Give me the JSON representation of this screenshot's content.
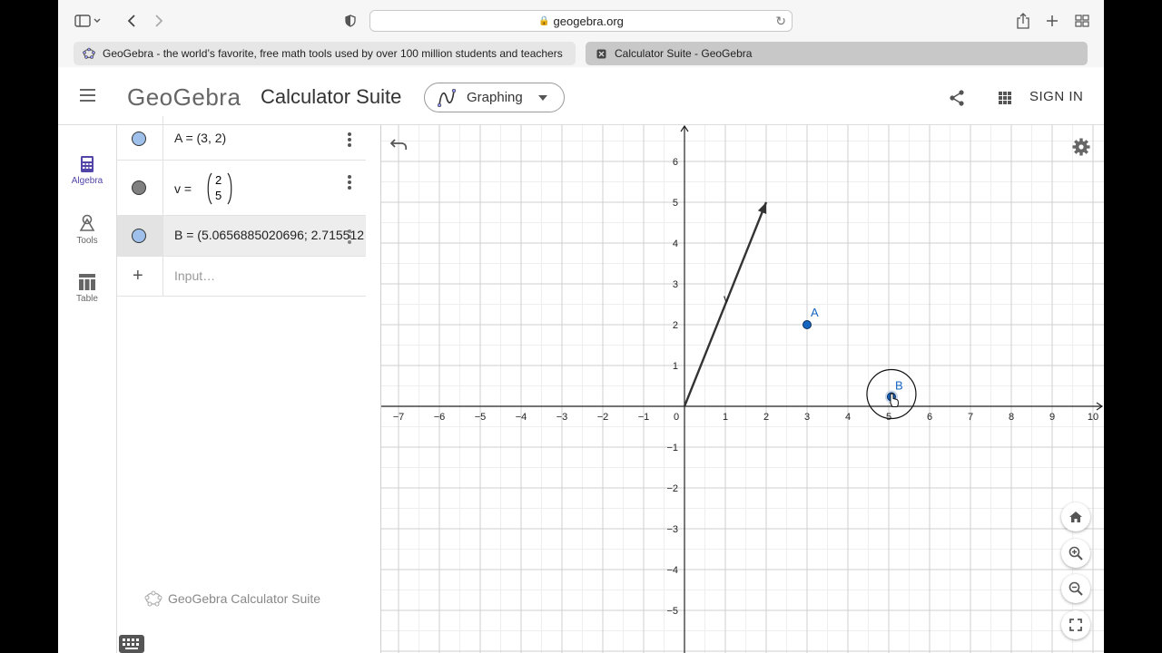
{
  "browser": {
    "url": "geogebra.org",
    "tabs": [
      {
        "title": "GeoGebra - the world’s favorite, free math tools used by over 100 million students and teachers"
      },
      {
        "title": "Calculator Suite - GeoGebra"
      }
    ]
  },
  "header": {
    "logo": "GeoGebra",
    "title": "Calculator Suite",
    "app_select": "Graphing",
    "sign_in": "SIGN IN"
  },
  "rail": {
    "items": [
      {
        "label": "Algebra",
        "active": true
      },
      {
        "label": "Tools",
        "active": false
      },
      {
        "label": "Table",
        "active": false
      }
    ]
  },
  "algebra": {
    "rows": [
      {
        "text": "A = (3, 2)",
        "color": "#9ec0ea"
      },
      {
        "lhs": "v =",
        "top": "2",
        "bottom": "5",
        "color": "#808080"
      },
      {
        "text": "B = (5.0656885020696; 2.715512",
        "color": "#9ec0ea"
      }
    ],
    "input_placeholder": "Input…",
    "add_symbol": "+",
    "watermark": "GeoGebra Calculator Suite"
  },
  "graph": {
    "x_ticks": [
      "−7",
      "−6",
      "−5",
      "−4",
      "−3",
      "−2",
      "−1",
      "0",
      "1",
      "2",
      "3",
      "4",
      "5",
      "6",
      "7",
      "8",
      "9",
      "10"
    ],
    "y_ticks": [
      "−5",
      "−4",
      "−3",
      "−2",
      "−1",
      "1",
      "2",
      "3",
      "4",
      "5",
      "6"
    ],
    "points": [
      {
        "label": "A",
        "x": 3,
        "y": 2,
        "color": "#1565c0"
      },
      {
        "label": "B",
        "x": 5.0656885020696,
        "y": 0.3,
        "color": "#1565c0"
      }
    ],
    "vector": {
      "label": "v",
      "dx": 2,
      "dy": 5
    },
    "colors": {
      "grid_minor": "#eeeeee",
      "grid_major": "#cfcfcf",
      "axis": "#222222",
      "accent": "#5145a8"
    }
  }
}
